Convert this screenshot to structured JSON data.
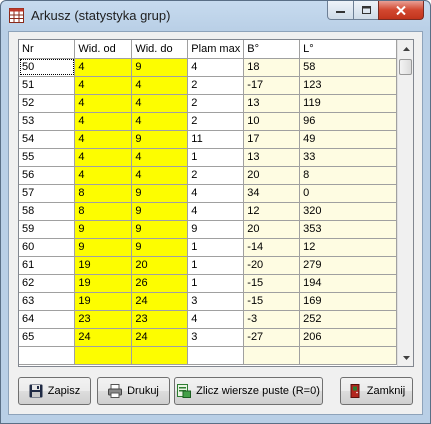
{
  "window": {
    "title": "Arkusz (statystyka grup)"
  },
  "table": {
    "headers": [
      "Nr",
      "Wid. od",
      "Wid. do",
      "Plam max",
      "B°",
      "L°"
    ],
    "rows": [
      [
        "50",
        "4",
        "9",
        "4",
        "18",
        "58"
      ],
      [
        "51",
        "4",
        "4",
        "2",
        "-17",
        "123"
      ],
      [
        "52",
        "4",
        "4",
        "2",
        "13",
        "119"
      ],
      [
        "53",
        "4",
        "4",
        "2",
        "10",
        "96"
      ],
      [
        "54",
        "4",
        "9",
        "11",
        "17",
        "49"
      ],
      [
        "55",
        "4",
        "4",
        "1",
        "13",
        "33"
      ],
      [
        "56",
        "4",
        "4",
        "2",
        "20",
        "8"
      ],
      [
        "57",
        "8",
        "9",
        "4",
        "34",
        "0"
      ],
      [
        "58",
        "8",
        "9",
        "4",
        "12",
        "320"
      ],
      [
        "59",
        "9",
        "9",
        "9",
        "20",
        "353"
      ],
      [
        "60",
        "9",
        "9",
        "1",
        "-14",
        "12"
      ],
      [
        "61",
        "19",
        "20",
        "1",
        "-20",
        "279"
      ],
      [
        "62",
        "19",
        "26",
        "1",
        "-15",
        "194"
      ],
      [
        "63",
        "19",
        "24",
        "3",
        "-15",
        "169"
      ],
      [
        "64",
        "23",
        "23",
        "4",
        "-3",
        "252"
      ],
      [
        "65",
        "24",
        "24",
        "3",
        "-27",
        "206"
      ],
      [
        "",
        "",
        "",
        "",
        "",
        ""
      ]
    ],
    "highlight_color": "#FDFD00",
    "light_column_color": "#FEFCE2"
  },
  "buttons": {
    "save": {
      "label": "Zapisz",
      "icon": "floppy-disk-icon"
    },
    "print": {
      "label": "Drukuj",
      "icon": "printer-icon"
    },
    "clear_empty": {
      "label": "Zlicz wiersze puste (R=0)",
      "icon": "clear-rows-icon"
    },
    "close": {
      "label": "Zamknij",
      "icon": "exit-door-icon"
    }
  }
}
